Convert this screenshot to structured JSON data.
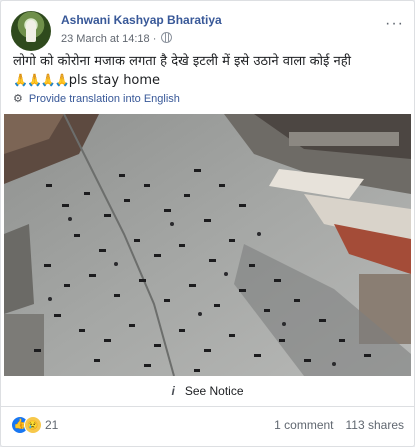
{
  "post": {
    "author": "Ashwani Kashyap Bharatiya",
    "date": "23 March at 14:18",
    "separator": " · ",
    "more_icon": "more-icon",
    "text_line1": "लोगो को कोरोना मजाक लगता है देखे इटली में इसे उठाने वाला कोई नही",
    "text_line2_emoji": "🙏🙏🙏🙏",
    "text_line2": "pls stay home",
    "translation_link": "Provide translation into English",
    "gear_icon": "gear-icon"
  },
  "media": {
    "image_description_icon": "photo-of-plaza-with-people-lying-down",
    "notice_label": "See Notice"
  },
  "footer": {
    "reaction_count": "21",
    "comments": "1 comment",
    "shares": "113 shares"
  }
}
